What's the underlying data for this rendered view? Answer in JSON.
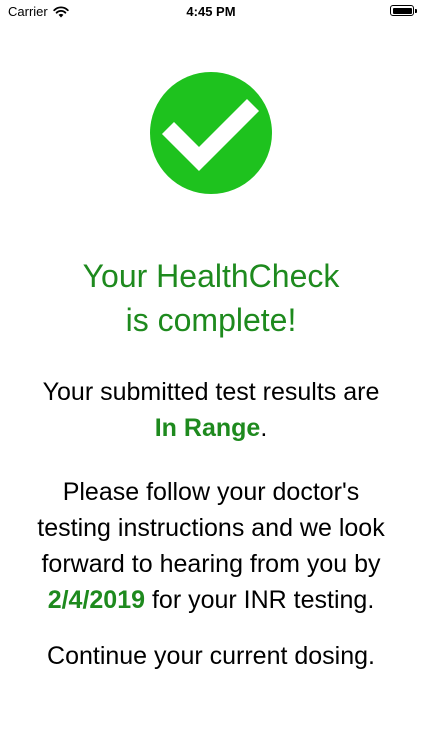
{
  "status_bar": {
    "carrier": "Carrier",
    "time": "4:45 PM"
  },
  "colors": {
    "accent_green": "#1e8a1e",
    "badge_green": "#1ec21e"
  },
  "headline": {
    "line1": "Your HealthCheck",
    "line2": "is complete!"
  },
  "result": {
    "prefix": "Your submitted test results are",
    "status": "In Range",
    "suffix": "."
  },
  "instructions": {
    "line1": "Please follow your doctor's",
    "line2": "testing instructions and we look",
    "line3": "forward to hearing from you by",
    "date": "2/4/2019",
    "line4_suffix": " for your INR testing."
  },
  "dosing": {
    "text": "Continue your current dosing."
  }
}
